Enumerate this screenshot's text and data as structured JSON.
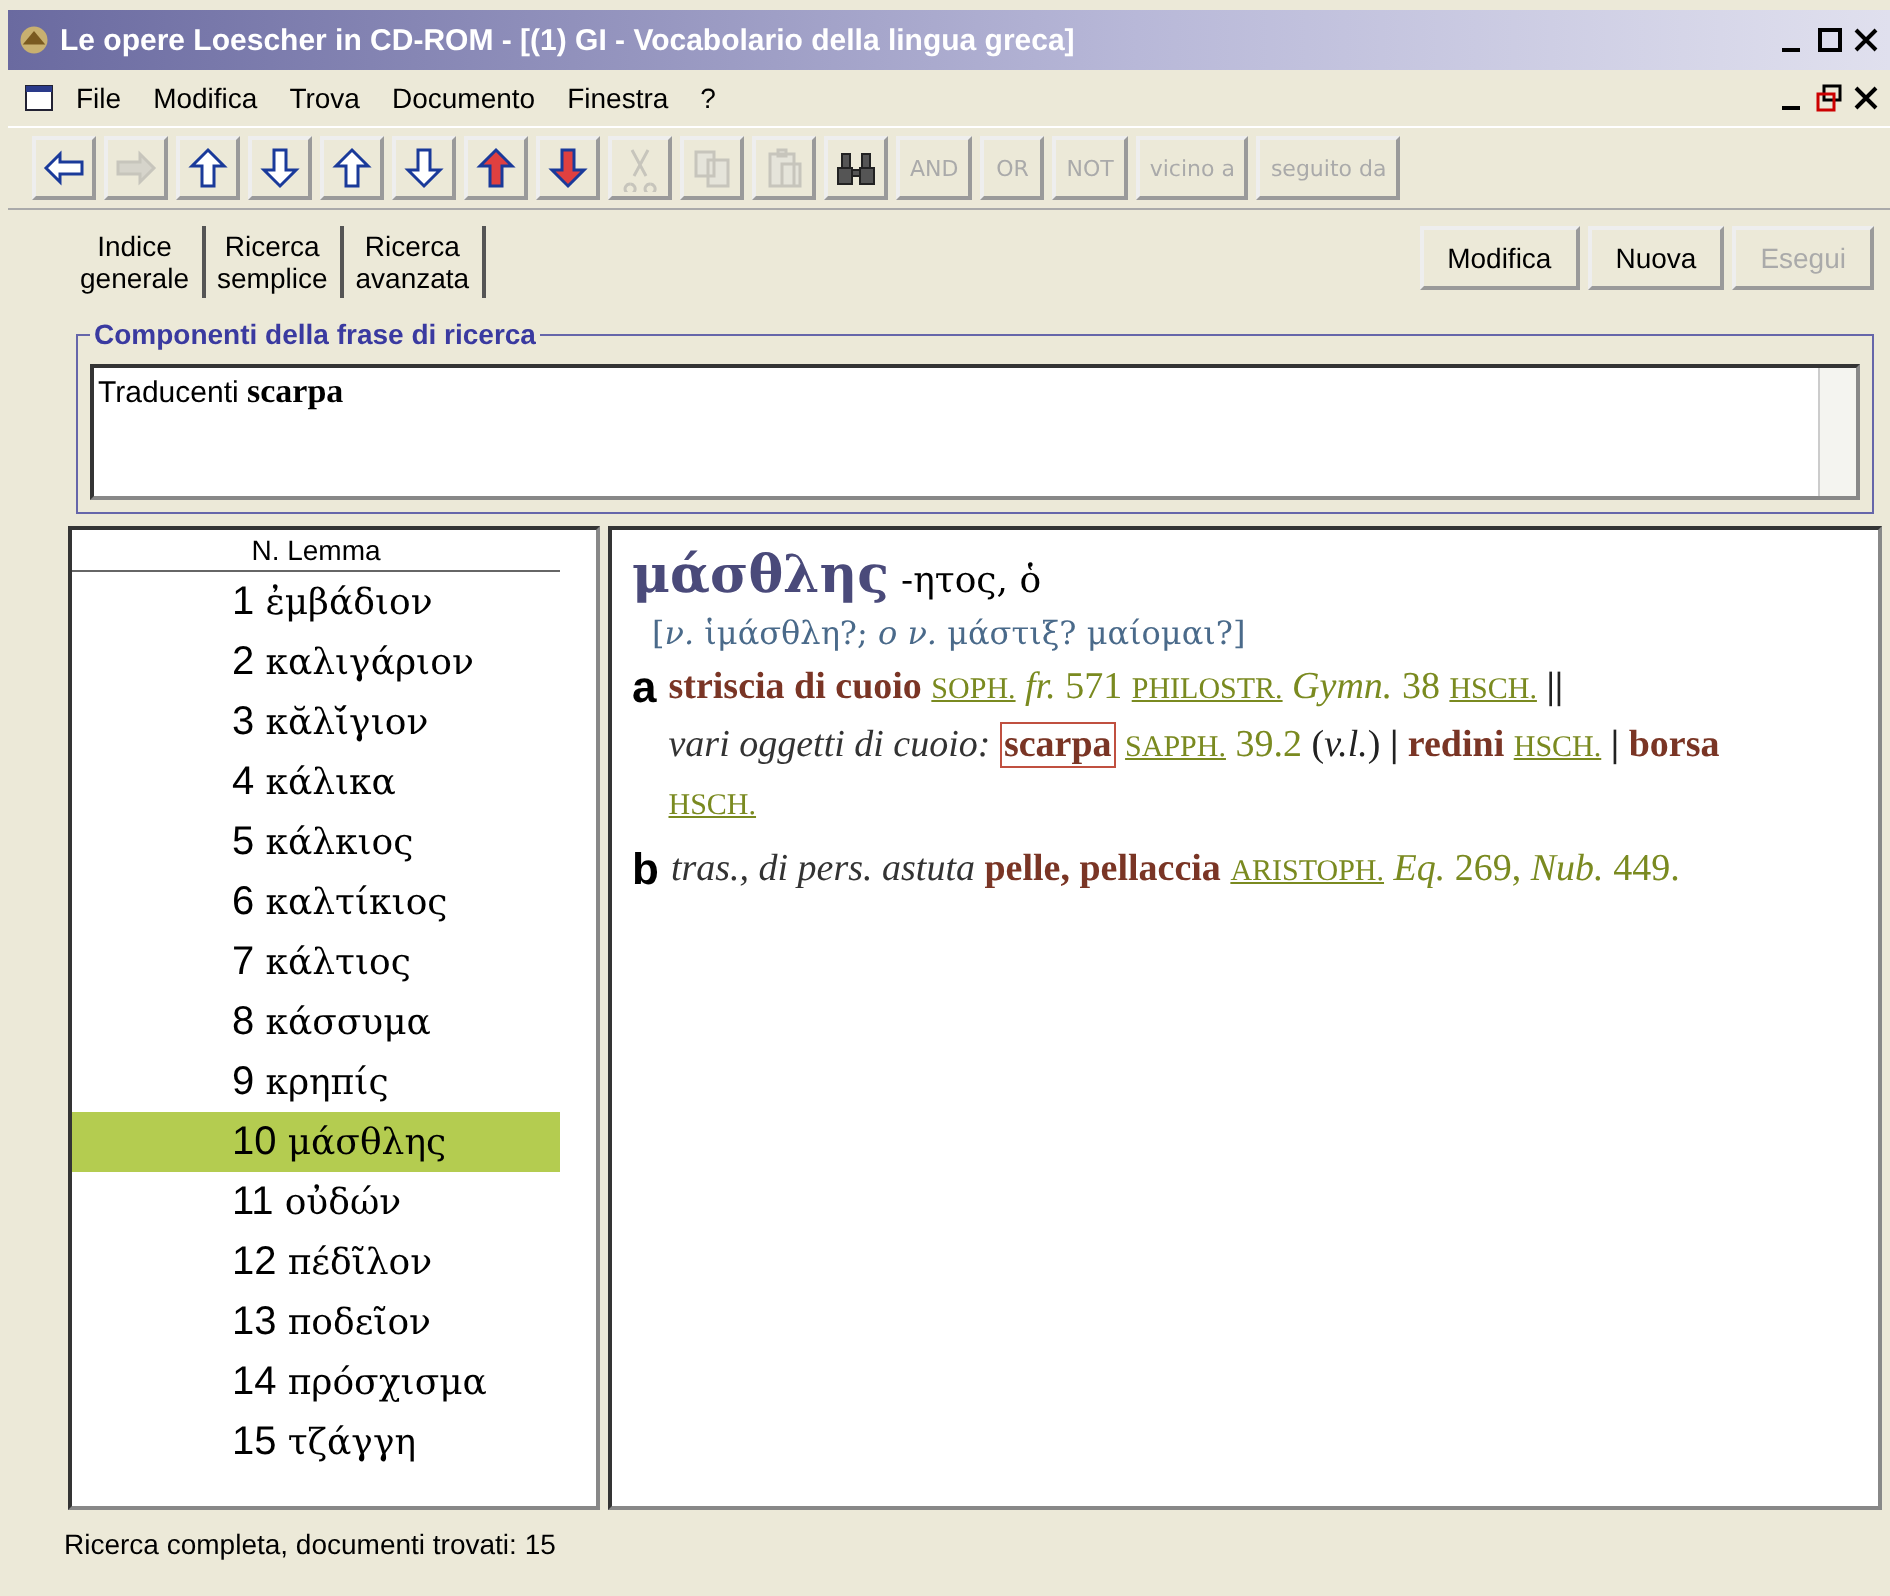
{
  "window": {
    "title": "Le opere Loescher in CD-ROM - [(1) GI - Vocabolario della lingua greca]"
  },
  "menu": [
    "File",
    "Modifica",
    "Trova",
    "Documento",
    "Finestra",
    "?"
  ],
  "toolbar": {
    "icons": [
      {
        "kind": "left",
        "disabled": false
      },
      {
        "kind": "right",
        "disabled": true
      },
      {
        "kind": "first",
        "disabled": false
      },
      {
        "kind": "last",
        "disabled": false
      },
      {
        "kind": "up",
        "disabled": false
      },
      {
        "kind": "down",
        "disabled": false
      },
      {
        "kind": "prev",
        "disabled": false
      },
      {
        "kind": "next",
        "disabled": false
      },
      {
        "kind": "cut",
        "disabled": true
      },
      {
        "kind": "copy",
        "disabled": true
      },
      {
        "kind": "paste",
        "disabled": true
      },
      {
        "kind": "find",
        "disabled": false
      }
    ],
    "operators": [
      {
        "label": "AND",
        "disabled": true
      },
      {
        "label": "OR",
        "disabled": true
      },
      {
        "label": "NOT",
        "disabled": true
      },
      {
        "label": "vicino a",
        "disabled": true
      },
      {
        "label": "seguito da",
        "disabled": true
      }
    ]
  },
  "search_tabs": [
    {
      "line1": "Indice",
      "line2": "generale"
    },
    {
      "line1": "Ricerca",
      "line2": "semplice"
    },
    {
      "line1": "Ricerca",
      "line2": "avanzata"
    }
  ],
  "actions": [
    {
      "label": "Modifica",
      "disabled": false
    },
    {
      "label": "Nuova",
      "disabled": false
    },
    {
      "label": "Esegui",
      "disabled": true
    }
  ],
  "query": {
    "legend": "Componenti della frase di ricerca",
    "text": "Traducenti **scarpa**"
  },
  "results": {
    "header": "N. Lemma",
    "items": [
      {
        "n": "1",
        "lemma": "ἐμβάδιον",
        "selected": false
      },
      {
        "n": "2",
        "lemma": "καλιγάριον",
        "selected": false
      },
      {
        "n": "3",
        "lemma": "κᾰλί̆γιον",
        "selected": false
      },
      {
        "n": "4",
        "lemma": "κάλικα",
        "selected": false
      },
      {
        "n": "5",
        "lemma": "κάλκιος",
        "selected": false
      },
      {
        "n": "6",
        "lemma": "καλτίκιος",
        "selected": false
      },
      {
        "n": "7",
        "lemma": "κάλτιος",
        "selected": false
      },
      {
        "n": "8",
        "lemma": "κάσσυμα",
        "selected": false
      },
      {
        "n": "9",
        "lemma": "κρηπίς",
        "selected": false
      },
      {
        "n": "10",
        "lemma": "μάσθλης",
        "selected": true
      },
      {
        "n": "11",
        "lemma": "οὐδών",
        "selected": false
      },
      {
        "n": "12",
        "lemma": "πέδῖλον",
        "selected": false
      },
      {
        "n": "13",
        "lemma": "ποδεῖον",
        "selected": false
      },
      {
        "n": "14",
        "lemma": "πρόσχισμα",
        "selected": false
      },
      {
        "n": "15",
        "lemma": "τζάγγη",
        "selected": false
      }
    ]
  },
  "entry": {
    "headword": "μάσθλης",
    "grammar": "-ητος, ὁ",
    "etymology": "[*ν.* ἱμάσθλη?; *ο ν.* μάστιξ? μαίομαι?]",
    "senses": [
      {
        "label": "a",
        "parts": [
          {
            "kind": "term",
            "text": "striscia di cuoio"
          },
          {
            "kind": "source",
            "text": "SOPH."
          },
          {
            "kind": "cite",
            "text": "*fr.* 571"
          },
          {
            "kind": "source",
            "text": "PHILOSTR."
          },
          {
            "kind": "cite",
            "text": "*Gymn.* 38"
          },
          {
            "kind": "source",
            "text": "HSCH."
          },
          {
            "kind": "bar",
            "text": "||"
          },
          {
            "kind": "gloss",
            "text": "vari oggetti di cuoio:"
          },
          {
            "kind": "hit",
            "text": "scarpa"
          },
          {
            "kind": "source",
            "text": "SAPPH."
          },
          {
            "kind": "cite",
            "text": "39.2"
          },
          {
            "kind": "text",
            "text": "(*v.l.*)"
          },
          {
            "kind": "bar",
            "text": "|"
          },
          {
            "kind": "term",
            "text": "redini"
          },
          {
            "kind": "source",
            "text": "HSCH."
          },
          {
            "kind": "bar",
            "text": "|"
          },
          {
            "kind": "term",
            "text": "borsa"
          },
          {
            "kind": "source",
            "text": "HSCH."
          }
        ]
      },
      {
        "label": "b",
        "parts": [
          {
            "kind": "gloss",
            "text": "tras., di pers. astuta"
          },
          {
            "kind": "term",
            "text": "pelle, pellaccia"
          },
          {
            "kind": "source",
            "text": "ARISTOPH."
          },
          {
            "kind": "cite",
            "text": "*Eq.* 269, *Nub.* 449."
          }
        ]
      }
    ]
  },
  "status_bar": "Ricerca completa, documenti trovati: 15"
}
